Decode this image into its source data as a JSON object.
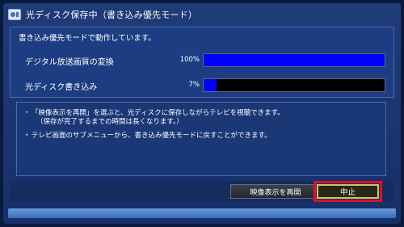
{
  "dialog": {
    "title": "光ディスク保存中（書き込み優先モード）",
    "title_icon": "disc-recorder-icon"
  },
  "status": {
    "message": "書き込み優先モードで動作しています。"
  },
  "progress": [
    {
      "label": "デジタル放送画質の変換",
      "percent_text": "100%",
      "value": 100
    },
    {
      "label": "光ディスク書き込み",
      "percent_text": "7%",
      "value": 7
    }
  ],
  "notes": {
    "note1_line1": "「映像表示を再開」を選ぶと、光ディスクに保存しながらテレビを視聴できます。",
    "note1_line2": "（保存が完了するまでの時間は長くなります。）",
    "note2_line1": "テレビ画面のサブメニューから、書き込み優先モードに戻すことができます。",
    "bullet": "・"
  },
  "buttons": {
    "resume_label": "映像表示を再開",
    "stop_label": "中止"
  },
  "colors": {
    "progress_fill": "#0000ff",
    "selection_outline": "#e0102a",
    "background": "#0a1a3c"
  }
}
